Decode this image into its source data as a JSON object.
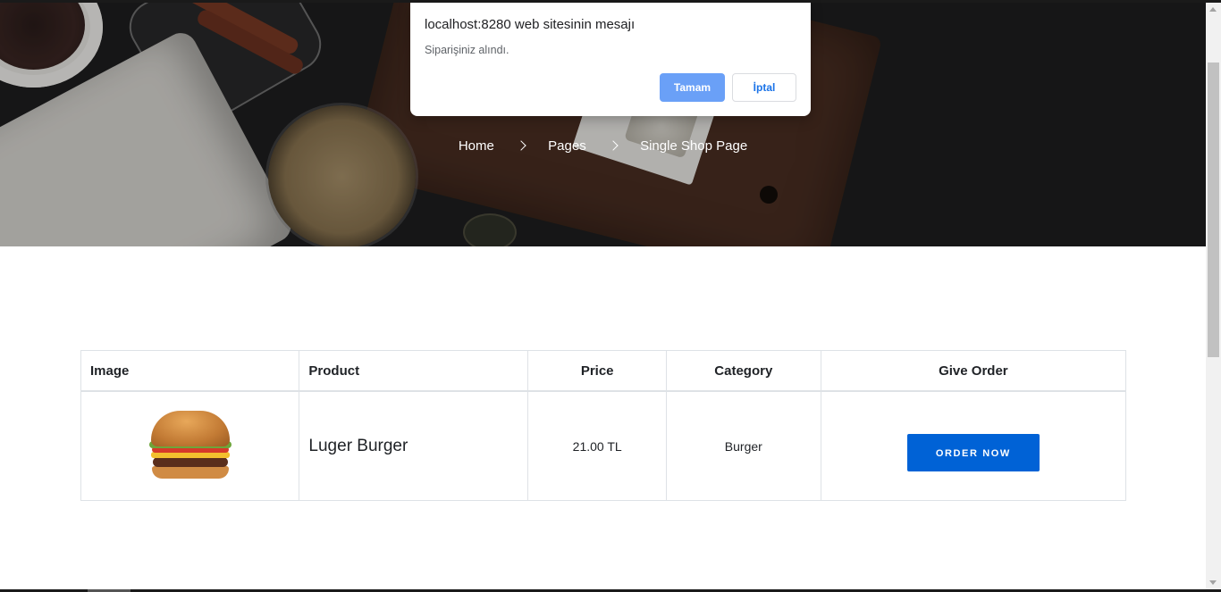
{
  "breadcrumb": {
    "items": [
      "Home",
      "Pages",
      "Single Shop Page"
    ]
  },
  "table": {
    "headers": {
      "image": "Image",
      "product": "Product",
      "price": "Price",
      "category": "Category",
      "give_order": "Give Order"
    },
    "rows": [
      {
        "image_icon": "burger-image",
        "product": "Luger Burger",
        "price": "21.00 TL",
        "category": "Burger",
        "button_label": "ORDER NOW"
      }
    ]
  },
  "dialog": {
    "title": "localhost:8280 web sitesinin mesajı",
    "message": "Siparişiniz alındı.",
    "ok_label": "Tamam",
    "cancel_label": "İptal"
  },
  "colors": {
    "primary_button": "#0062d6",
    "dialog_ok": "#6aa0f7",
    "dialog_cancel_text": "#1a73e8"
  }
}
